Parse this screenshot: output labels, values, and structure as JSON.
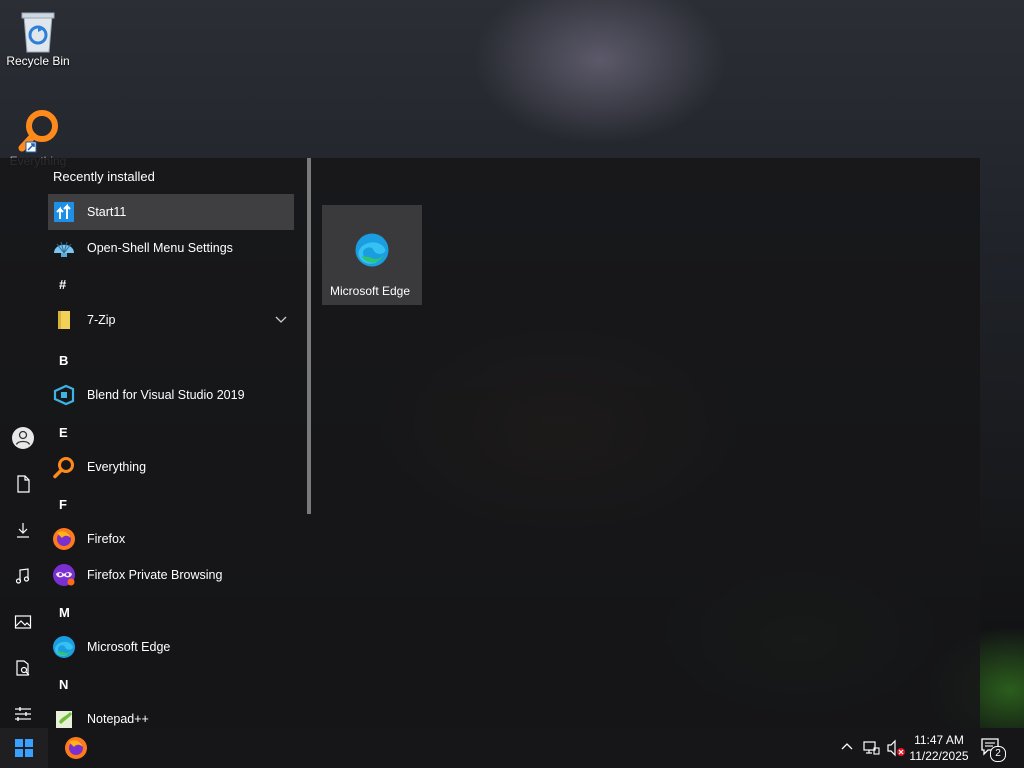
{
  "desktop": {
    "icons": [
      {
        "label": "Recycle Bin"
      },
      {
        "label": "Everything"
      }
    ]
  },
  "start_menu": {
    "section_title": "Recently installed",
    "recent": [
      {
        "label": "Start11",
        "selected": true
      },
      {
        "label": "Open-Shell Menu Settings"
      }
    ],
    "groups": [
      {
        "letter": "#",
        "items": [
          {
            "label": "7-Zip",
            "expandable": true
          }
        ]
      },
      {
        "letter": "B",
        "items": [
          {
            "label": "Blend for Visual Studio 2019"
          }
        ]
      },
      {
        "letter": "E",
        "items": [
          {
            "label": "Everything"
          }
        ]
      },
      {
        "letter": "F",
        "items": [
          {
            "label": "Firefox"
          },
          {
            "label": "Firefox Private Browsing"
          }
        ]
      },
      {
        "letter": "M",
        "items": [
          {
            "label": "Microsoft Edge"
          }
        ]
      },
      {
        "letter": "N",
        "items": [
          {
            "label": "Notepad++"
          }
        ]
      }
    ],
    "tiles": [
      {
        "label": "Microsoft Edge"
      }
    ],
    "rail_icons": [
      "user-icon",
      "documents-icon",
      "downloads-icon",
      "music-icon",
      "pictures-icon",
      "file-explorer-icon",
      "settings-icon"
    ]
  },
  "taskbar": {
    "pinned": [
      "firefox-icon"
    ],
    "tray_icons": [
      "chevron-up-icon",
      "network-icon",
      "volume-muted-icon"
    ],
    "time": "11:47 AM",
    "date": "11/22/2025",
    "notification_count": "2"
  },
  "colors": {
    "accent_blue": "#0078d4",
    "selected_bg": "#3f3f41",
    "menu_bg": "#161618"
  }
}
